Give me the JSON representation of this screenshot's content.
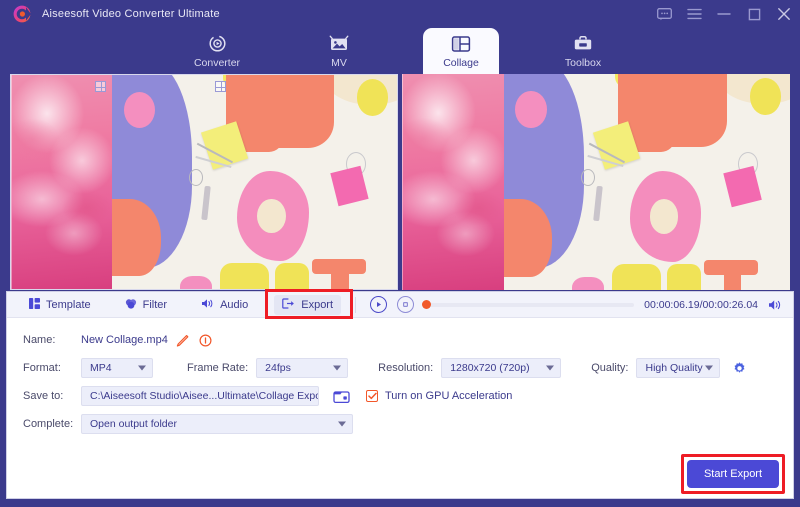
{
  "window": {
    "title": "Aiseesoft Video Converter Ultimate",
    "logo_icon": "aiseesoft-logo-icon",
    "controls": [
      {
        "name": "feedback-icon",
        "label": "Feedback"
      },
      {
        "name": "menu-icon",
        "label": "Menu"
      },
      {
        "name": "minimize-icon",
        "label": "Minimize"
      },
      {
        "name": "maximize-icon",
        "label": "Maximize"
      },
      {
        "name": "close-icon",
        "label": "Close"
      }
    ]
  },
  "nav": {
    "tabs": [
      {
        "label": "Converter",
        "icon": "converter-icon",
        "active": false
      },
      {
        "label": "MV",
        "icon": "mv-icon",
        "active": false
      },
      {
        "label": "Collage",
        "icon": "collage-icon",
        "active": true
      },
      {
        "label": "Toolbox",
        "icon": "toolbox-icon",
        "active": false
      }
    ]
  },
  "preview": {
    "editing_panel_label": "Collage editing canvas",
    "preview_panel_label": "Collage preview"
  },
  "toolbar": {
    "tabs": [
      {
        "label": "Template",
        "icon": "template-icon",
        "active": false
      },
      {
        "label": "Filter",
        "icon": "filter-icon",
        "active": false
      },
      {
        "label": "Audio",
        "icon": "audio-icon",
        "active": false
      },
      {
        "label": "Export",
        "icon": "export-icon",
        "active": true
      }
    ],
    "highlighted_tab": "Export"
  },
  "player": {
    "play_icon": "play-icon",
    "stop_icon": "stop-icon",
    "volume_icon": "volume-icon",
    "current_time": "00:00:06.19",
    "total_time": "00:00:26.04",
    "time_display": "00:00:06.19/00:00:26.04",
    "progress_percent": 2
  },
  "export_form": {
    "name_label": "Name:",
    "name_value": "New Collage.mp4",
    "edit_icon": "pencil-edit-icon",
    "info_icon": "info-icon",
    "format_label": "Format:",
    "format_value": "MP4",
    "frame_rate_label": "Frame Rate:",
    "frame_rate_value": "24fps",
    "resolution_label": "Resolution:",
    "resolution_value": "1280x720 (720p)",
    "quality_label": "Quality:",
    "quality_value": "High Quality",
    "settings_icon": "gear-icon",
    "save_to_label": "Save to:",
    "save_to_value": "C:\\Aiseesoft Studio\\Aisee...Ultimate\\Collage Exported",
    "browse_dots": "...",
    "folder_icon": "folder-open-icon",
    "gpu_checkbox_label": "Turn on GPU Acceleration",
    "gpu_checkbox_checked": true,
    "check_icon": "checkmark-icon",
    "complete_label": "Complete:",
    "complete_value": "Open output folder"
  },
  "actions": {
    "start_export_label": "Start Export",
    "start_export_highlighted": true
  },
  "colors": {
    "brand_purple": "#3b3a8c",
    "accent_blue": "#4b49d6",
    "highlight_red": "#ee1c25",
    "accent_orange": "#f2572a",
    "panel_bg": "#ffffff",
    "toolbar_bg": "#f2f3fb",
    "field_bg": "#eceefa"
  }
}
